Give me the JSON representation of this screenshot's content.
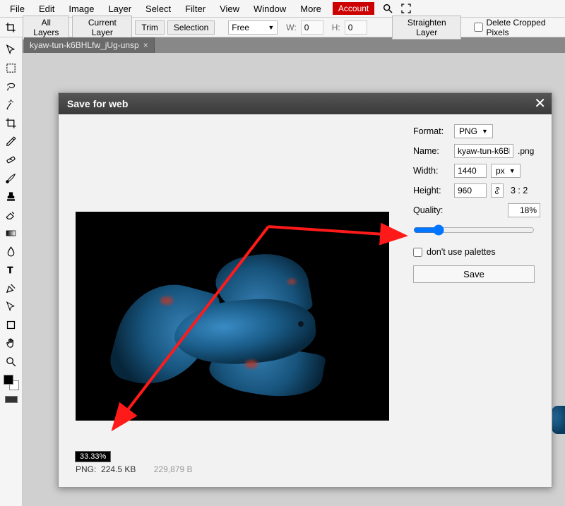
{
  "menu": {
    "items": [
      "File",
      "Edit",
      "Image",
      "Layer",
      "Select",
      "Filter",
      "View",
      "Window",
      "More"
    ],
    "account": "Account"
  },
  "options": {
    "all_layers": "All Layers",
    "current_layer": "Current Layer",
    "trim": "Trim",
    "selection": "Selection",
    "constraint": "Free",
    "w_label": "W:",
    "w_value": "0",
    "h_label": "H:",
    "h_value": "0",
    "straighten": "Straighten Layer",
    "delete_cropped": "Delete Cropped Pixels"
  },
  "tab": {
    "name": "kyaw-tun-k6BHLfw_jUg-unsp"
  },
  "dialog": {
    "title": "Save for web",
    "format_label": "Format:",
    "format_value": "PNG",
    "name_label": "Name:",
    "name_value": "kyaw-tun-k6BHl",
    "name_ext": ".png",
    "width_label": "Width:",
    "width_value": "1440",
    "width_unit": "px",
    "height_label": "Height:",
    "height_value": "960",
    "ratio": "3 : 2",
    "quality_label": "Quality:",
    "quality_value": "18%",
    "slider_value": 18,
    "palettes_label": "don't use palettes",
    "save": "Save",
    "zoom": "33.33%",
    "format_short": "PNG:",
    "filesize": "224.5 KB",
    "bytes": "229,879 B"
  }
}
